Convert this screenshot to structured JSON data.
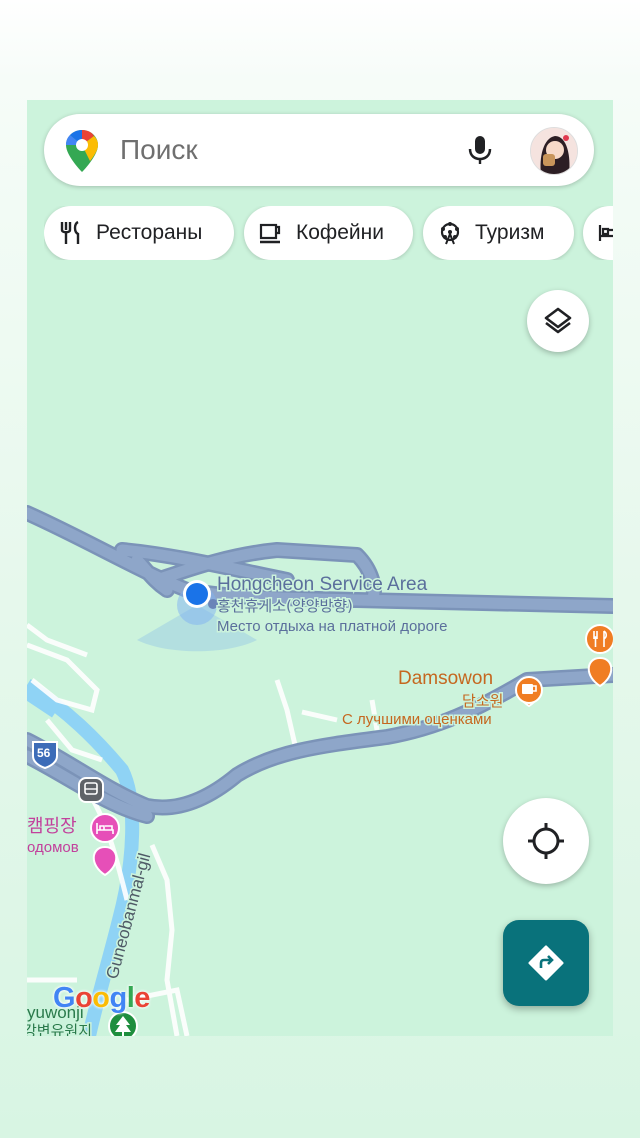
{
  "search": {
    "placeholder": "Поиск"
  },
  "chips": [
    {
      "label": "Рестораны",
      "icon": "restaurant-icon"
    },
    {
      "label": "Кофейни",
      "icon": "coffee-icon"
    },
    {
      "label": "Туризм",
      "icon": "attractions-icon"
    },
    {
      "label": "",
      "icon": "hotel-icon"
    }
  ],
  "map": {
    "places": {
      "service_area": {
        "name": "Hongcheon Service Area",
        "name_local": "홍천휴게소(양양방향)",
        "subtitle": "Место отдыха на платной дороге"
      },
      "damsowon": {
        "name": "Damsowon",
        "name_local": "담소원",
        "subtitle": "С лучшими оценками"
      },
      "camping": {
        "name_local": "캠핑장",
        "subtitle": "одомов"
      },
      "bottom_place": {
        "name": "yuwonji",
        "name_local": "강변유원지"
      }
    },
    "road_labels": {
      "route_shield": "56",
      "road_name": "Guneobanmal-gil"
    },
    "attribution": "Google"
  },
  "colors": {
    "map_background": "#ccf3dc",
    "highway": "#8ea6c9",
    "highway_outline": "#7b93b8",
    "river": "#8fd3f5",
    "location_dot": "#1a73e8",
    "directions_button": "#09727b",
    "cafe_pin": "#f07d23",
    "lodging_pin": "#e64fb8",
    "park_pin": "#1e8e3e"
  }
}
